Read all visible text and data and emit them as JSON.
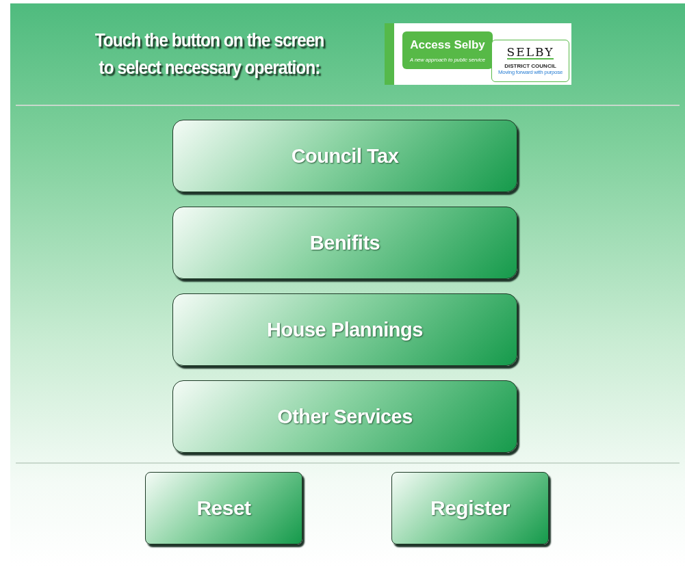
{
  "header": {
    "instruction_lines": [
      "Touch the button on the screen",
      "to select necessary operation:"
    ]
  },
  "logo": {
    "title": "Access Selby",
    "tagline": "A new approach to public service",
    "council_name": "SELBY",
    "council_subtitle": "DISTRICT COUNCIL",
    "council_motto": "Moving forward with purpose"
  },
  "menu_buttons": [
    "Council Tax",
    "Benifits",
    "House Plannings",
    "Other Services"
  ],
  "footer_buttons": [
    "Reset",
    "Register"
  ]
}
